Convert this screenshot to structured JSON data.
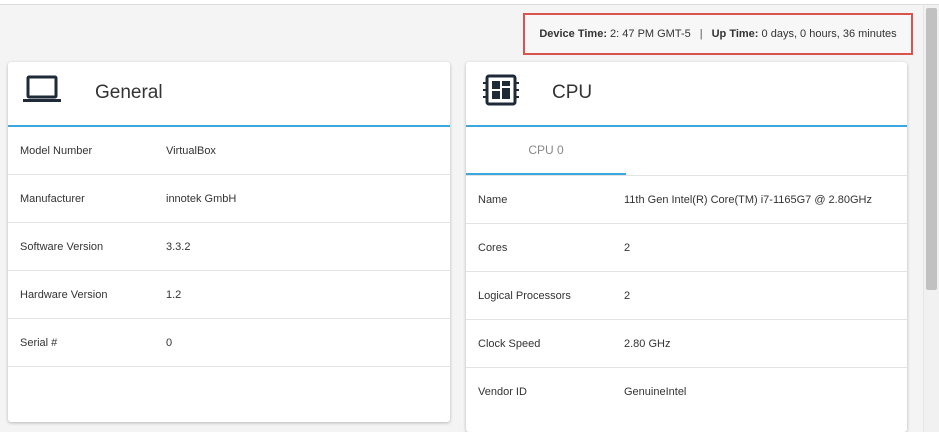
{
  "device_info": {
    "device_time_label": "Device Time:",
    "device_time_value": "2: 47 PM GMT-5",
    "separator": "|",
    "up_time_label": "Up Time:",
    "up_time_value": "0 days, 0 hours, 36 minutes",
    "highlight_color": "#d9534f"
  },
  "general": {
    "title": "General",
    "icon": "laptop-icon",
    "rows": [
      {
        "label": "Model Number",
        "value": "VirtualBox"
      },
      {
        "label": "Manufacturer",
        "value": "innotek GmbH"
      },
      {
        "label": "Software Version",
        "value": "3.3.2"
      },
      {
        "label": "Hardware Version",
        "value": "1.2"
      },
      {
        "label": "Serial #",
        "value": "0"
      }
    ]
  },
  "cpu": {
    "title": "CPU",
    "icon": "cpu-chip-icon",
    "tabs": [
      {
        "label": "CPU 0",
        "active": true
      }
    ],
    "rows": [
      {
        "label": "Name",
        "value": "11th Gen Intel(R) Core(TM) i7-1165G7 @ 2.80GHz"
      },
      {
        "label": "Cores",
        "value": "2"
      },
      {
        "label": "Logical Processors",
        "value": "2"
      },
      {
        "label": "Clock Speed",
        "value": "2.80 GHz"
      },
      {
        "label": "Vendor ID",
        "value": "GenuineIntel"
      }
    ]
  },
  "accent_color": "#3aa8de"
}
